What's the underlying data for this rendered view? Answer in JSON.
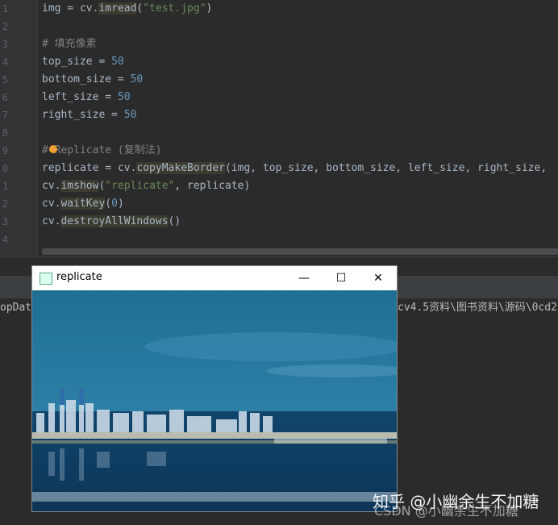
{
  "editor": {
    "line_numbers": [
      "1",
      "2",
      "3",
      "4",
      "5",
      "6",
      "7",
      "8",
      "9",
      "0",
      "1",
      "2",
      "3",
      "4"
    ],
    "lines": [
      {
        "num": "1",
        "tokens": [
          {
            "t": "img = cv.",
            "c": "kw"
          },
          {
            "t": "imread",
            "c": "hl"
          },
          {
            "t": "(",
            "c": "kw"
          },
          {
            "t": "\"test.jpg\"",
            "c": "str"
          },
          {
            "t": ")",
            "c": "kw"
          }
        ]
      },
      {
        "num": "2",
        "tokens": []
      },
      {
        "num": "3",
        "tokens": [
          {
            "t": "# 填充像素",
            "c": "cm"
          }
        ]
      },
      {
        "num": "4",
        "tokens": [
          {
            "t": "top_size = ",
            "c": "kw"
          },
          {
            "t": "50",
            "c": "num"
          }
        ]
      },
      {
        "num": "5",
        "tokens": [
          {
            "t": "bottom_size = ",
            "c": "kw"
          },
          {
            "t": "50",
            "c": "num"
          }
        ]
      },
      {
        "num": "6",
        "tokens": [
          {
            "t": "left_size = ",
            "c": "kw"
          },
          {
            "t": "50",
            "c": "num"
          }
        ]
      },
      {
        "num": "7",
        "tokens": [
          {
            "t": "right_size = ",
            "c": "kw"
          },
          {
            "t": "50",
            "c": "num"
          }
        ]
      },
      {
        "num": "8",
        "tokens": []
      },
      {
        "num": "9",
        "tokens": [
          {
            "t": "# Replicate (复制法)",
            "c": "cm"
          }
        ]
      },
      {
        "num": "0",
        "tokens": [
          {
            "t": "replicate = cv.",
            "c": "kw"
          },
          {
            "t": "copyMakeBorder",
            "c": "hl"
          },
          {
            "t": "(img, top_size, bottom_size, left_size, right_size,",
            "c": "kw"
          }
        ]
      },
      {
        "num": "1",
        "tokens": [
          {
            "t": "cv.",
            "c": "kw"
          },
          {
            "t": "imshow",
            "c": "hl"
          },
          {
            "t": "(",
            "c": "kw"
          },
          {
            "t": "\"replicate\"",
            "c": "str"
          },
          {
            "t": ", replicate)",
            "c": "kw"
          }
        ]
      },
      {
        "num": "2",
        "tokens": [
          {
            "t": "cv.",
            "c": "kw"
          },
          {
            "t": "waitKey",
            "c": "hl"
          },
          {
            "t": "(",
            "c": "kw"
          },
          {
            "t": "0",
            "c": "num"
          },
          {
            "t": ")",
            "c": "kw"
          }
        ]
      },
      {
        "num": "3",
        "tokens": [
          {
            "t": "cv.",
            "c": "kw"
          },
          {
            "t": "destroyAllWindows",
            "c": "hl"
          },
          {
            "t": "()",
            "c": "kw"
          }
        ]
      },
      {
        "num": "4",
        "tokens": []
      }
    ]
  },
  "console": {
    "left_text": "opData",
    "right_text": "cv4.5资料\\图书资料\\源码\\0cd2"
  },
  "window": {
    "title": "replicate",
    "minimize": "—",
    "maximize": "☐",
    "close": "✕"
  },
  "watermark": {
    "main": "知乎 @小幽余生不加糖",
    "sub": "CSDN @小幽余生不加糖"
  },
  "colors": {
    "string": "#6a8759",
    "number": "#6897bb",
    "comment": "#808080",
    "text": "#a9b7c6",
    "background": "#2b2b2b"
  }
}
